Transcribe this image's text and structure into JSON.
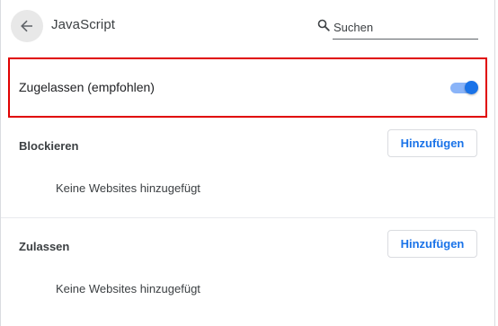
{
  "header": {
    "title": "JavaScript",
    "back_icon": "arrow-left-icon",
    "search": {
      "placeholder": "Suchen",
      "value": "",
      "icon": "search-icon"
    }
  },
  "main_setting": {
    "label": "Zugelassen (empfohlen)",
    "toggle_on": true,
    "highlight_color": "#e00000"
  },
  "sections": [
    {
      "heading": "Blockieren",
      "button_label": "Hinzufügen",
      "empty_text": "Keine Websites hinzugefügt"
    },
    {
      "heading": "Zulassen",
      "button_label": "Hinzufügen",
      "empty_text": "Keine Websites hinzugefügt"
    }
  ],
  "colors": {
    "accent": "#1a73e8",
    "toggle_track": "#8ab4f8"
  }
}
